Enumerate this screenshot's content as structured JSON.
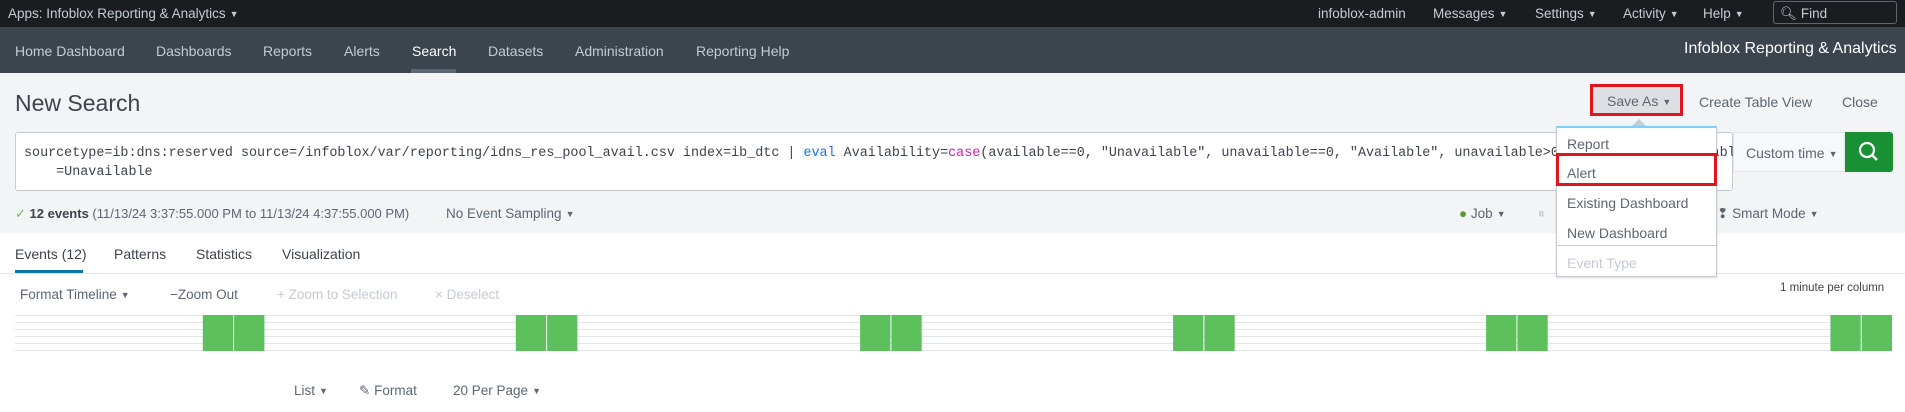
{
  "topbar": {
    "app": "Apps: Infoblox Reporting & Analytics",
    "user": "infoblox-admin",
    "messages": "Messages",
    "settings": "Settings",
    "activity": "Activity",
    "help": "Help",
    "find_placeholder": "Find"
  },
  "nav": {
    "items": [
      "Home Dashboard",
      "Dashboards",
      "Reports",
      "Alerts",
      "Search",
      "Datasets",
      "Administration",
      "Reporting Help"
    ],
    "active": "Search",
    "brand": "Infoblox Reporting & Analytics"
  },
  "header": {
    "title": "New Search",
    "save_as": "Save As",
    "create_table_view": "Create Table View",
    "close": "Close"
  },
  "search": {
    "query_parts": [
      "sourcetype=ib:dns:reserved source=/infoblox/var/reporting/idns_res_pool_avail.csv index=ib_dtc | ",
      "eval",
      " Availability=",
      "case",
      "(available==0, \"Unavailable\", unavailable==0, \"Available\", unavailable>0,  \"Partially Available\") |"
    ],
    "query_line2": "    =Unavailable",
    "time_picker": "Custom time"
  },
  "save_as_menu": {
    "items": [
      "Report",
      "Alert",
      "Existing Dashboard",
      "New Dashboard",
      "Event Type"
    ],
    "highlighted": "Alert",
    "disabled": [
      "Event Type"
    ]
  },
  "status": {
    "count": "12 events",
    "range": "(11/13/24 3:37:55.000 PM to 11/13/24 4:37:55.000 PM)",
    "sampling": "No Event Sampling",
    "job": "Job",
    "mode": "Smart Mode"
  },
  "tabs": [
    {
      "label": "Events (12)",
      "active": true
    },
    {
      "label": "Patterns"
    },
    {
      "label": "Statistics"
    },
    {
      "label": "Visualization"
    }
  ],
  "timeline": {
    "format": "Format Timeline",
    "zoom_out": "Zoom Out",
    "zoom_sel": "Zoom to Selection",
    "deselect": "Deselect",
    "scale": "1 minute per column"
  },
  "results": {
    "list": "List",
    "format": "Format",
    "per_page": "20 Per Page"
  },
  "colors": {
    "bar": "#5cc05c",
    "search_button": "#1a9035",
    "highlight": "#e0161e"
  },
  "chart_data": {
    "type": "bar",
    "columns": 60,
    "bar_columns": [
      6,
      7,
      16,
      17,
      27,
      28,
      37,
      38,
      47,
      48,
      58,
      59
    ],
    "values_per_bar": 1,
    "ylim": [
      0,
      1
    ]
  }
}
